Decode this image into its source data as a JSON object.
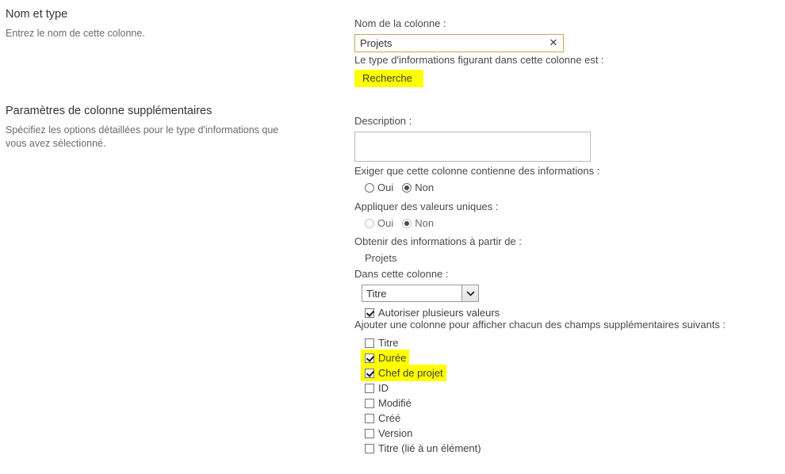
{
  "left_panel": {
    "sections": [
      {
        "title": "Nom et type",
        "description": "Entrez le nom de cette colonne."
      },
      {
        "title": "Paramètres de colonne supplémentaires",
        "description": "Spécifiez les options détaillées pour le type d'informations que vous avez sélectionné."
      }
    ]
  },
  "form": {
    "column_name": {
      "label": "Nom de la colonne :",
      "value": "Projets",
      "clear_icon": "close-icon",
      "clear_glyph": "✕"
    },
    "type_info": {
      "label": "Le type d'informations figurant dans cette colonne est :",
      "value": "Recherche",
      "highlight_color": "#ffff00"
    },
    "description": {
      "label": "Description :",
      "value": "",
      "placeholder": ""
    },
    "required": {
      "label": "Exiger que cette colonne contienne des informations :",
      "options": [
        "Oui",
        "Non"
      ],
      "selected": "Non",
      "disabled": false
    },
    "unique": {
      "label": "Appliquer des valeurs uniques :",
      "options": [
        "Oui",
        "Non"
      ],
      "selected": "Non",
      "disabled": true
    },
    "source_list": {
      "label": "Obtenir des informations à partir de :",
      "value": "Projets"
    },
    "source_column": {
      "label": "Dans cette colonne :",
      "value": "Titre",
      "options": [
        "Titre"
      ],
      "chevron_icon": "chevron-down-icon"
    },
    "allow_multiple": {
      "label": "Autoriser plusieurs valeurs",
      "checked": true
    },
    "additional_fields": {
      "label": "Ajouter une colonne pour afficher chacun des champs supplémentaires suivants :",
      "items": [
        {
          "label": "Titre",
          "checked": false,
          "highlighted": false
        },
        {
          "label": "Durée",
          "checked": true,
          "highlighted": true
        },
        {
          "label": "Chef de projet",
          "checked": true,
          "highlighted": true
        },
        {
          "label": "ID",
          "checked": false,
          "highlighted": false
        },
        {
          "label": "Modifié",
          "checked": false,
          "highlighted": false
        },
        {
          "label": "Créé",
          "checked": false,
          "highlighted": false
        },
        {
          "label": "Version",
          "checked": false,
          "highlighted": false
        },
        {
          "label": "Titre (lié à un élément)",
          "checked": false,
          "highlighted": false
        }
      ]
    }
  }
}
